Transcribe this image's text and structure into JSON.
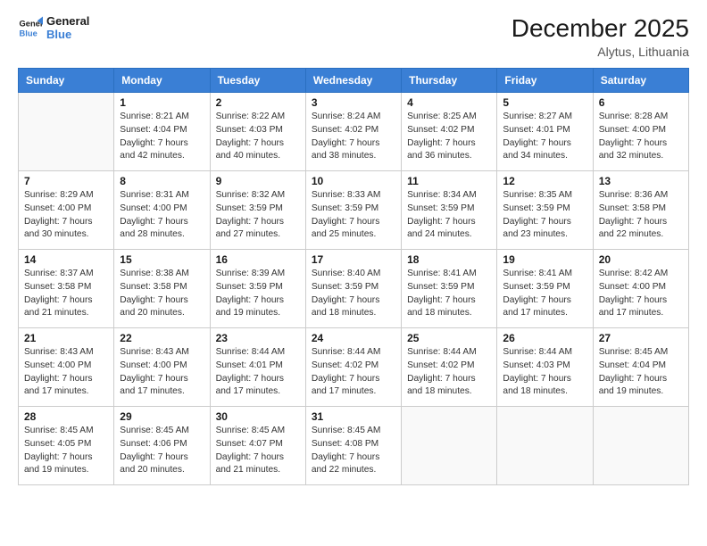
{
  "logo": {
    "line1": "General",
    "line2": "Blue"
  },
  "header": {
    "month": "December 2025",
    "location": "Alytus, Lithuania"
  },
  "weekdays": [
    "Sunday",
    "Monday",
    "Tuesday",
    "Wednesday",
    "Thursday",
    "Friday",
    "Saturday"
  ],
  "weeks": [
    [
      {
        "day": "",
        "info": ""
      },
      {
        "day": "1",
        "info": "Sunrise: 8:21 AM\nSunset: 4:04 PM\nDaylight: 7 hours\nand 42 minutes."
      },
      {
        "day": "2",
        "info": "Sunrise: 8:22 AM\nSunset: 4:03 PM\nDaylight: 7 hours\nand 40 minutes."
      },
      {
        "day": "3",
        "info": "Sunrise: 8:24 AM\nSunset: 4:02 PM\nDaylight: 7 hours\nand 38 minutes."
      },
      {
        "day": "4",
        "info": "Sunrise: 8:25 AM\nSunset: 4:02 PM\nDaylight: 7 hours\nand 36 minutes."
      },
      {
        "day": "5",
        "info": "Sunrise: 8:27 AM\nSunset: 4:01 PM\nDaylight: 7 hours\nand 34 minutes."
      },
      {
        "day": "6",
        "info": "Sunrise: 8:28 AM\nSunset: 4:00 PM\nDaylight: 7 hours\nand 32 minutes."
      }
    ],
    [
      {
        "day": "7",
        "info": "Sunrise: 8:29 AM\nSunset: 4:00 PM\nDaylight: 7 hours\nand 30 minutes."
      },
      {
        "day": "8",
        "info": "Sunrise: 8:31 AM\nSunset: 4:00 PM\nDaylight: 7 hours\nand 28 minutes."
      },
      {
        "day": "9",
        "info": "Sunrise: 8:32 AM\nSunset: 3:59 PM\nDaylight: 7 hours\nand 27 minutes."
      },
      {
        "day": "10",
        "info": "Sunrise: 8:33 AM\nSunset: 3:59 PM\nDaylight: 7 hours\nand 25 minutes."
      },
      {
        "day": "11",
        "info": "Sunrise: 8:34 AM\nSunset: 3:59 PM\nDaylight: 7 hours\nand 24 minutes."
      },
      {
        "day": "12",
        "info": "Sunrise: 8:35 AM\nSunset: 3:59 PM\nDaylight: 7 hours\nand 23 minutes."
      },
      {
        "day": "13",
        "info": "Sunrise: 8:36 AM\nSunset: 3:58 PM\nDaylight: 7 hours\nand 22 minutes."
      }
    ],
    [
      {
        "day": "14",
        "info": "Sunrise: 8:37 AM\nSunset: 3:58 PM\nDaylight: 7 hours\nand 21 minutes."
      },
      {
        "day": "15",
        "info": "Sunrise: 8:38 AM\nSunset: 3:58 PM\nDaylight: 7 hours\nand 20 minutes."
      },
      {
        "day": "16",
        "info": "Sunrise: 8:39 AM\nSunset: 3:59 PM\nDaylight: 7 hours\nand 19 minutes."
      },
      {
        "day": "17",
        "info": "Sunrise: 8:40 AM\nSunset: 3:59 PM\nDaylight: 7 hours\nand 18 minutes."
      },
      {
        "day": "18",
        "info": "Sunrise: 8:41 AM\nSunset: 3:59 PM\nDaylight: 7 hours\nand 18 minutes."
      },
      {
        "day": "19",
        "info": "Sunrise: 8:41 AM\nSunset: 3:59 PM\nDaylight: 7 hours\nand 17 minutes."
      },
      {
        "day": "20",
        "info": "Sunrise: 8:42 AM\nSunset: 4:00 PM\nDaylight: 7 hours\nand 17 minutes."
      }
    ],
    [
      {
        "day": "21",
        "info": "Sunrise: 8:43 AM\nSunset: 4:00 PM\nDaylight: 7 hours\nand 17 minutes."
      },
      {
        "day": "22",
        "info": "Sunrise: 8:43 AM\nSunset: 4:00 PM\nDaylight: 7 hours\nand 17 minutes."
      },
      {
        "day": "23",
        "info": "Sunrise: 8:44 AM\nSunset: 4:01 PM\nDaylight: 7 hours\nand 17 minutes."
      },
      {
        "day": "24",
        "info": "Sunrise: 8:44 AM\nSunset: 4:02 PM\nDaylight: 7 hours\nand 17 minutes."
      },
      {
        "day": "25",
        "info": "Sunrise: 8:44 AM\nSunset: 4:02 PM\nDaylight: 7 hours\nand 18 minutes."
      },
      {
        "day": "26",
        "info": "Sunrise: 8:44 AM\nSunset: 4:03 PM\nDaylight: 7 hours\nand 18 minutes."
      },
      {
        "day": "27",
        "info": "Sunrise: 8:45 AM\nSunset: 4:04 PM\nDaylight: 7 hours\nand 19 minutes."
      }
    ],
    [
      {
        "day": "28",
        "info": "Sunrise: 8:45 AM\nSunset: 4:05 PM\nDaylight: 7 hours\nand 19 minutes."
      },
      {
        "day": "29",
        "info": "Sunrise: 8:45 AM\nSunset: 4:06 PM\nDaylight: 7 hours\nand 20 minutes."
      },
      {
        "day": "30",
        "info": "Sunrise: 8:45 AM\nSunset: 4:07 PM\nDaylight: 7 hours\nand 21 minutes."
      },
      {
        "day": "31",
        "info": "Sunrise: 8:45 AM\nSunset: 4:08 PM\nDaylight: 7 hours\nand 22 minutes."
      },
      {
        "day": "",
        "info": ""
      },
      {
        "day": "",
        "info": ""
      },
      {
        "day": "",
        "info": ""
      }
    ]
  ]
}
